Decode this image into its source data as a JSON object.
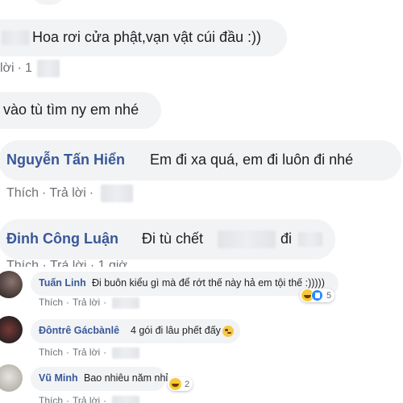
{
  "comments": [
    {
      "text": "Hoa rơi cửa phật,vạn vật cúi đầu :))",
      "actions": {
        "reply": "lời",
        "time": "1"
      }
    },
    {
      "text": "vào tù tìm ny em nhé"
    },
    {
      "author": "Nguyễn Tấn Hiển",
      "text": "Em đi xa quá, em đi luôn đi nhé",
      "actions": {
        "like": "Thích",
        "reply": "Trả lời"
      }
    },
    {
      "author": "Đinh Công Luận",
      "text_before": "Đi tù chết",
      "text_after": "đi",
      "actions": {
        "partial": "Thích · Trả lời · 1 giờ"
      }
    }
  ],
  "replies": [
    {
      "author": "Tuấn Linh",
      "text": "Đi buôn kiểu gì mà để rớt thế này hả em tội thế :)))))",
      "actions": {
        "like": "Thích",
        "reply": "Trả lời"
      },
      "reaction_count": "5",
      "reactions": [
        "haha-icon",
        "like-icon"
      ]
    },
    {
      "author": "Đôntrê Gácbànlê",
      "text": "4 gói đi lâu phết đấy",
      "actions": {
        "like": "Thích",
        "reply": "Trả lời"
      }
    },
    {
      "author": "Vũ Minh",
      "text": "Bao nhiêu năm nhỉ",
      "actions": {
        "like": "Thích",
        "reply": "Trả lời"
      },
      "reaction_count": "2",
      "reactions": [
        "haha-icon"
      ]
    }
  ],
  "colors": {
    "author": "#385898",
    "bubble": "#f2f3f5",
    "meta": "#6e7075"
  }
}
